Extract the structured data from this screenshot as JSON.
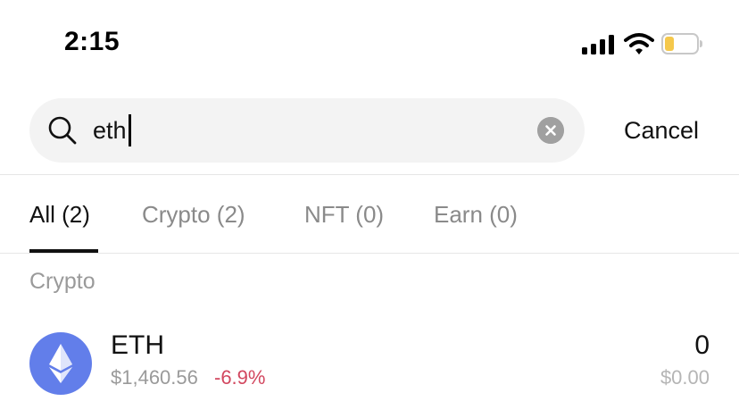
{
  "status_bar": {
    "time": "2:15",
    "icons": [
      "cellular-signal-icon",
      "wifi-icon",
      "battery-icon"
    ],
    "battery_color": "#f5c84b"
  },
  "search": {
    "query": "eth",
    "icons": [
      "search-icon",
      "clear-icon"
    ],
    "cancel_label": "Cancel"
  },
  "tabs": [
    {
      "label": "All (2)",
      "active": true
    },
    {
      "label": "Crypto (2)",
      "active": false
    },
    {
      "label": "NFT (0)",
      "active": false
    },
    {
      "label": "Earn (0)",
      "active": false
    }
  ],
  "results": {
    "section_label": "Crypto",
    "items": [
      {
        "symbol": "ETH",
        "icon": "ethereum-logo-icon",
        "price": "$1,460.56",
        "change": "-6.9%",
        "change_color": "#d2475f",
        "balance": "0",
        "value": "$0.00"
      }
    ]
  },
  "colors": {
    "eth_brand": "#627eea",
    "search_bg": "#f3f3f3",
    "negative": "#d2475f"
  }
}
